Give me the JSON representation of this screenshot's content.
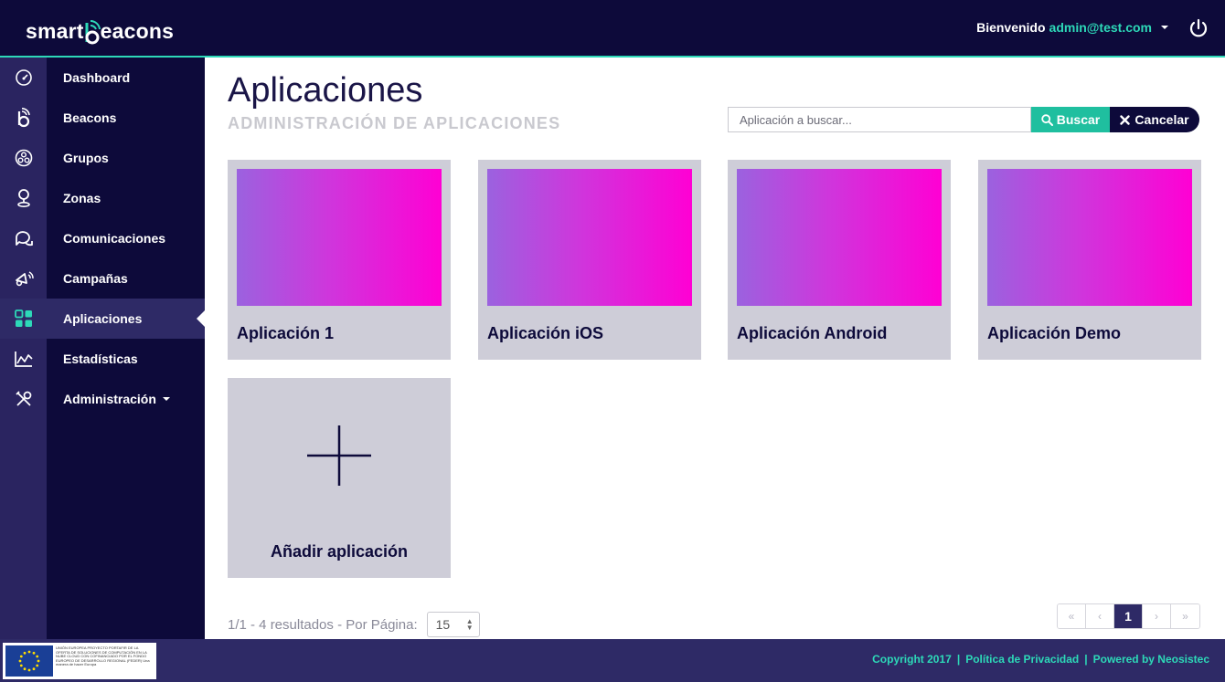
{
  "header": {
    "logo_left": "smart",
    "logo_right": "eacons",
    "welcome_label": "Bienvenido",
    "user": "admin@test.com",
    "power_icon": "power-icon"
  },
  "sidebar": {
    "items": [
      {
        "label": "Dashboard",
        "icon": "dashboard-gauge-icon"
      },
      {
        "label": "Beacons",
        "icon": "beacon-icon"
      },
      {
        "label": "Grupos",
        "icon": "groups-icon"
      },
      {
        "label": "Zonas",
        "icon": "location-pin-icon"
      },
      {
        "label": "Comunicaciones",
        "icon": "chat-bubbles-icon"
      },
      {
        "label": "Campañas",
        "icon": "megaphone-icon"
      },
      {
        "label": "Aplicaciones",
        "icon": "apps-grid-icon",
        "active": true
      },
      {
        "label": "Estadísticas",
        "icon": "line-chart-icon"
      },
      {
        "label": "Administración",
        "icon": "tools-icon",
        "dropdown": true
      }
    ]
  },
  "main": {
    "title": "Aplicaciones",
    "subtitle": "ADMINISTRACIÓN DE APLICACIONES",
    "search": {
      "placeholder": "Aplicación a buscar...",
      "value": "",
      "search_label": "Buscar",
      "cancel_label": "Cancelar"
    },
    "apps": [
      {
        "name": "Aplicación 1"
      },
      {
        "name": "Aplicación iOS"
      },
      {
        "name": "Aplicación Android"
      },
      {
        "name": "Aplicación Demo"
      }
    ],
    "add_label": "Añadir aplicación",
    "results_text": "1/1 - 4 resultados - Por Página:",
    "per_page": "15",
    "pagination": {
      "first": "«",
      "prev": "‹",
      "current": "1",
      "next": "›",
      "last": "»"
    }
  },
  "footer": {
    "copyright": "Copyright 2017",
    "privacy": "Política de Privacidad",
    "powered": "Powered by Neosistec",
    "eu_text": "UNIÓN EUROPEA\nPROYECTO PORTAFIR DE LA OFERTA DE SOLUCIONES DE COMPUTACIÓN EN LA NUBE CLOUD CON COFINANCIADO POR EL FONDO EUROPEO DE DESARROLLO REGIONAL (FEDER)\nUna manera de hacer Europa"
  },
  "colors": {
    "navy": "#0d0a3a",
    "accent": "#2dd9b8",
    "search_button": "#1fbf9f",
    "card_bg": "#cecdd8",
    "gradient_start": "#9b62df",
    "gradient_end": "#ff00d4"
  }
}
